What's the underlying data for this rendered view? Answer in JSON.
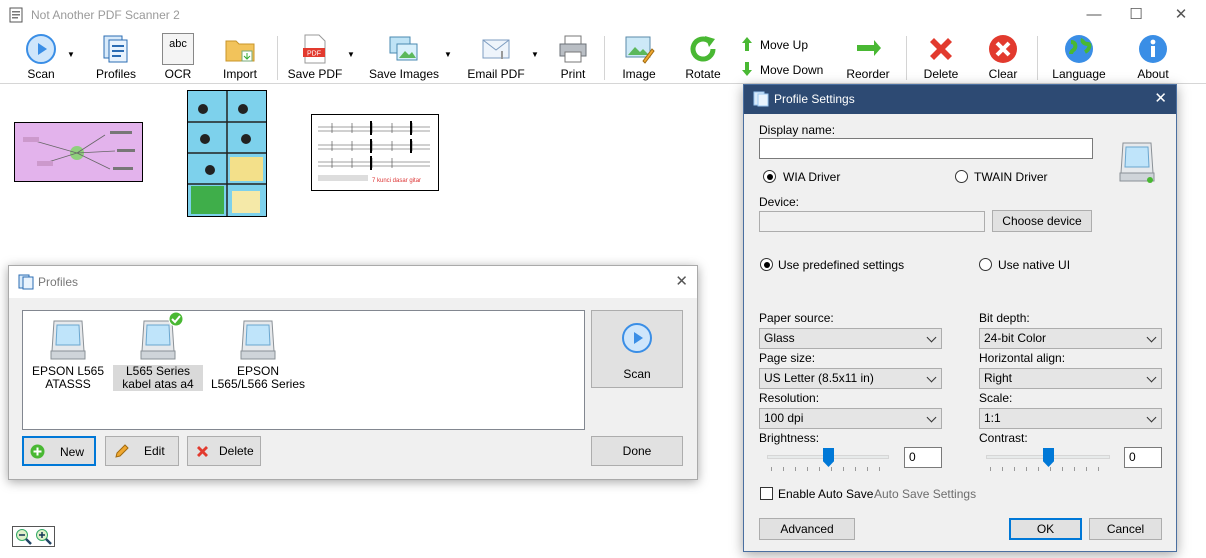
{
  "window": {
    "title": "Not Another PDF Scanner 2",
    "minimize": "—",
    "maximize": "☐",
    "close": "✕"
  },
  "toolbar": {
    "scan": "Scan",
    "profiles": "Profiles",
    "ocr": "OCR",
    "import": "Import",
    "save_pdf": "Save PDF",
    "save_images": "Save Images",
    "email_pdf": "Email PDF",
    "print": "Print",
    "image": "Image",
    "rotate": "Rotate",
    "move_up": "Move Up",
    "move_down": "Move Down",
    "reorder": "Reorder",
    "delete": "Delete",
    "clear": "Clear",
    "language": "Language",
    "about": "About",
    "ocr_icon_text": "abc",
    "pdf_icon_text": "PDF"
  },
  "thumbnails": {
    "guitar_caption": "7 kunci dasar gitar"
  },
  "profiles_dialog": {
    "title": "Profiles",
    "items": [
      {
        "label": "EPSON L565 ATASSS",
        "selected": false,
        "is_default": false
      },
      {
        "label": "L565 Series kabel atas a4",
        "selected": true,
        "is_default": true
      },
      {
        "label": "EPSON L565/L566 Series",
        "selected": false,
        "is_default": false
      }
    ],
    "scan": "Scan",
    "new": "New",
    "edit": "Edit",
    "delete": "Delete",
    "done": "Done"
  },
  "settings_dialog": {
    "title": "Profile Settings",
    "display_name_label": "Display name:",
    "display_name_value": "",
    "wia_driver": "WIA Driver",
    "twain_driver": "TWAIN Driver",
    "driver_selected": "WIA Driver",
    "device_label": "Device:",
    "device_value": "",
    "choose_device": "Choose device",
    "use_predefined": "Use predefined settings",
    "use_native": "Use native UI",
    "mode_selected": "Use predefined settings",
    "paper_source_label": "Paper source:",
    "paper_source_value": "Glass",
    "bit_depth_label": "Bit depth:",
    "bit_depth_value": "24-bit Color",
    "page_size_label": "Page size:",
    "page_size_value": "US Letter (8.5x11 in)",
    "horizontal_align_label": "Horizontal align:",
    "horizontal_align_value": "Right",
    "resolution_label": "Resolution:",
    "resolution_value": "100 dpi",
    "scale_label": "Scale:",
    "scale_value": "1:1",
    "brightness_label": "Brightness:",
    "brightness_value": "0",
    "contrast_label": "Contrast:",
    "contrast_value": "0",
    "enable_auto_save": "Enable Auto Save",
    "auto_save_checked": false,
    "auto_save_settings": "Auto Save Settings",
    "advanced": "Advanced",
    "ok": "OK",
    "cancel": "Cancel",
    "close": "✕"
  },
  "colors": {
    "accent": "#0078d7",
    "dialog_title": "#2d4a73",
    "scan_blue": "#3a8ee6",
    "delete_red": "#e23a2e"
  }
}
